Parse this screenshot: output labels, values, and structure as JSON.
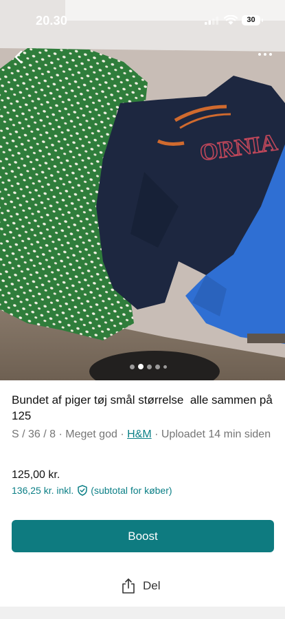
{
  "status_bar": {
    "time": "20.30",
    "battery": "30"
  },
  "icons": {
    "back": "back-arrow-icon",
    "more": "more-dots-icon",
    "share": "share-icon",
    "shield": "shield-check-icon"
  },
  "photo": {
    "carousel_count": 5,
    "active_index": 1
  },
  "item": {
    "title": "Bundet af piger tøj smål størrelse  alle sammen på 125",
    "size": "S / 36 / 8",
    "separator": " · ",
    "condition": "Meget god",
    "brand": "H&M",
    "uploaded": "Uploadet 14 min siden"
  },
  "pricing": {
    "price": "125,00 kr.",
    "incl_price": "136,25 kr. inkl.",
    "incl_note": "(subtotal for køber)"
  },
  "actions": {
    "boost_label": "Boost",
    "share_label": "Del"
  },
  "colors": {
    "accent": "#0e7b80",
    "link": "#0b7f86"
  }
}
